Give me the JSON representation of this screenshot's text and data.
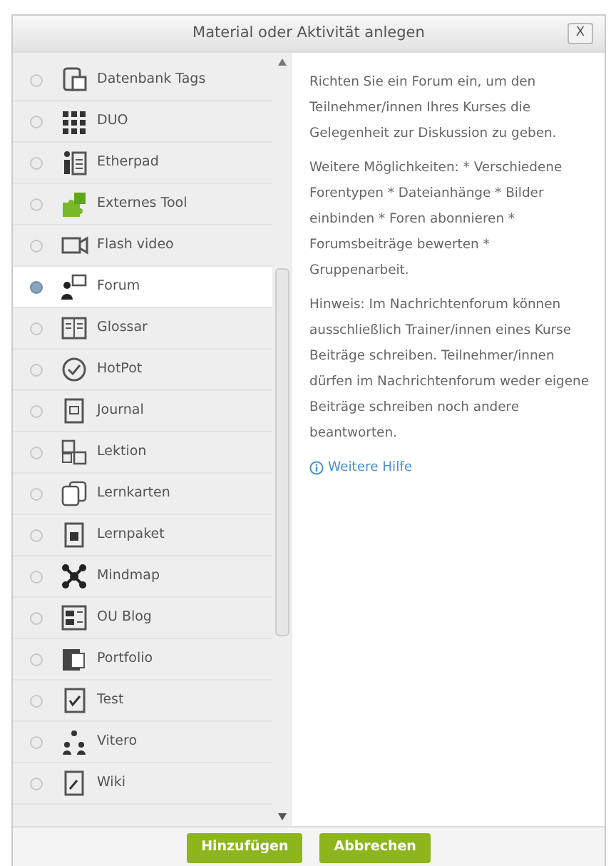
{
  "dialog": {
    "title": "Material oder Aktivität anlegen",
    "close": "X"
  },
  "activities": [
    {
      "label": "Datenbank Tags",
      "selected": false
    },
    {
      "label": "DUO",
      "selected": false
    },
    {
      "label": "Etherpad",
      "selected": false
    },
    {
      "label": "Externes Tool",
      "selected": false
    },
    {
      "label": "Flash video",
      "selected": false
    },
    {
      "label": "Forum",
      "selected": true
    },
    {
      "label": "Glossar",
      "selected": false
    },
    {
      "label": "HotPot",
      "selected": false
    },
    {
      "label": "Journal",
      "selected": false
    },
    {
      "label": "Lektion",
      "selected": false
    },
    {
      "label": "Lernkarten",
      "selected": false
    },
    {
      "label": "Lernpaket",
      "selected": false
    },
    {
      "label": "Mindmap",
      "selected": false
    },
    {
      "label": "OU Blog",
      "selected": false
    },
    {
      "label": "Portfolio",
      "selected": false
    },
    {
      "label": "Test",
      "selected": false
    },
    {
      "label": "Vitero",
      "selected": false
    },
    {
      "label": "Wiki",
      "selected": false
    }
  ],
  "description": {
    "paragraphs": [
      "Richten Sie ein Forum ein, um den Teilnehmer/innen Ihres Kurses die Gelegenheit zur Diskussion zu geben.",
      "Weitere Möglichkeiten: * Verschiedene Forentypen * Dateianhänge * Bilder einbinden * Foren abonnieren * Forumsbeiträge bewerten * Gruppenarbeit.",
      "Hinweis: Im Nachrichtenforum können ausschließlich Trainer/innen eines Kurse Beiträge schreiben. Teilnehmer/innen dürfen im Nachrichtenforum weder eigene Beiträge schreiben noch andere beantworten."
    ],
    "help_link": "Weitere Hilfe"
  },
  "buttons": [
    "Hinzufügen",
    "Abbrechen"
  ]
}
